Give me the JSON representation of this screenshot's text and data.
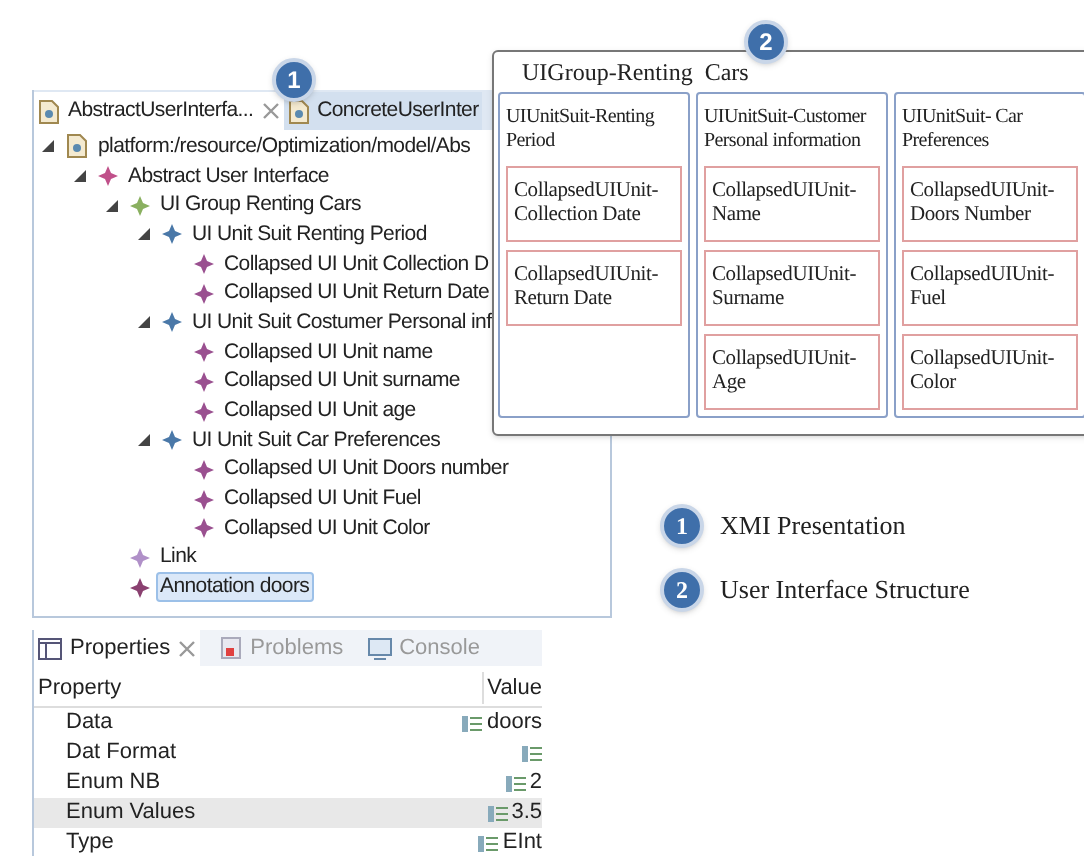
{
  "editor_tabs": [
    {
      "label": "AbstractUserInterfa...",
      "selected": true,
      "closable": true
    },
    {
      "label": "ConcreteUserInter",
      "selected": false,
      "closable": false
    }
  ],
  "tab_badge": "1",
  "tree": [
    {
      "kind": "resource",
      "label": "platform:/resource/Optimization/model/Abs",
      "expanded": true,
      "children": [
        {
          "kind": "element",
          "color": "#c0508a",
          "label": "Abstract User Interface",
          "expanded": true,
          "children": [
            {
              "kind": "element",
              "color": "#8ab060",
              "label": "UI Group Renting Cars",
              "expanded": true,
              "children": [
                {
                  "kind": "element",
                  "color": "#4a78a8",
                  "label": "UI Unit Suit Renting Period",
                  "expanded": true,
                  "children": [
                    {
                      "kind": "element",
                      "color": "#9a5090",
                      "label": "Collapsed UI Unit Collection D"
                    },
                    {
                      "kind": "element",
                      "color": "#9a5090",
                      "label": "Collapsed UI Unit Return Date"
                    }
                  ]
                },
                {
                  "kind": "element",
                  "color": "#4a78a8",
                  "label": "UI Unit Suit Costumer Personal inf",
                  "expanded": true,
                  "children": [
                    {
                      "kind": "element",
                      "color": "#9a5090",
                      "label": "Collapsed UI Unit name"
                    },
                    {
                      "kind": "element",
                      "color": "#9a5090",
                      "label": "Collapsed UI Unit surname"
                    },
                    {
                      "kind": "element",
                      "color": "#9a5090",
                      "label": "Collapsed UI Unit age"
                    }
                  ]
                },
                {
                  "kind": "element",
                  "color": "#4a78a8",
                  "label": "UI Unit Suit Car Preferences",
                  "expanded": true,
                  "children": [
                    {
                      "kind": "element",
                      "color": "#9a5090",
                      "label": "Collapsed UI Unit Doors number"
                    },
                    {
                      "kind": "element",
                      "color": "#9a5090",
                      "label": "Collapsed UI Unit Fuel"
                    },
                    {
                      "kind": "element",
                      "color": "#9a5090",
                      "label": "Collapsed UI Unit Color"
                    }
                  ]
                }
              ]
            },
            {
              "kind": "element",
              "color": "#b090c8",
              "label": "Link"
            },
            {
              "kind": "element",
              "color": "#8a4070",
              "label": "Annotation doors",
              "selected": true
            }
          ]
        }
      ]
    }
  ],
  "view_tabs": [
    {
      "kind": "properties",
      "label": "Properties",
      "selected": true,
      "closable": true
    },
    {
      "kind": "problems",
      "label": "Problems",
      "selected": false,
      "closable": false
    },
    {
      "kind": "console",
      "label": "Console",
      "selected": false,
      "closable": false
    }
  ],
  "properties": {
    "columns": [
      "Property",
      "Value"
    ],
    "rows": [
      {
        "property": "Data",
        "value": "doors",
        "selected": false
      },
      {
        "property": "Dat Format",
        "selected": false
      },
      {
        "property": "Enum NB",
        "value": "2",
        "selected": false
      },
      {
        "property": "Enum Values",
        "value": "3.5",
        "selected": true
      },
      {
        "property": "Type",
        "value": "EInt",
        "selected": false
      }
    ]
  },
  "diagram": {
    "title": "UIGroup-Renting  Cars",
    "badge": "2",
    "suits": [
      {
        "title": "UIUnitSuit-Renting Period",
        "units": [
          "CollapsedUIUnit-Collection Date",
          "CollapsedUIUnit-Return Date"
        ]
      },
      {
        "title": "UIUnitSuit-Customer Personal information",
        "units": [
          "CollapsedUIUnit-Name",
          "CollapsedUIUnit-Surname",
          "CollapsedUIUnit-Age"
        ]
      },
      {
        "title": "UIUnitSuit- Car Preferences",
        "units": [
          "CollapsedUIUnit-Doors Number",
          "CollapsedUIUnit-Fuel",
          "CollapsedUIUnit-Color"
        ]
      }
    ]
  },
  "legend": [
    {
      "number": "1",
      "label": "XMI Presentation"
    },
    {
      "number": "2",
      "label": "User Interface Structure"
    }
  ]
}
